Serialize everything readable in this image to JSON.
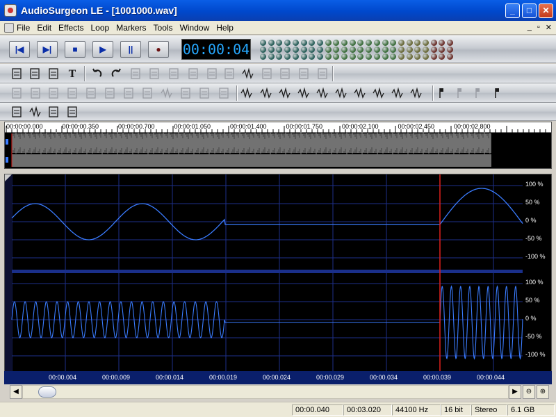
{
  "window": {
    "title": "AudioSurgeon LE - [1001000.wav]",
    "minimize": "_",
    "maximize": "□",
    "close": "✕"
  },
  "menu": {
    "items": [
      {
        "label": "File",
        "u": "F"
      },
      {
        "label": "Edit",
        "u": "E"
      },
      {
        "label": "Effects",
        "u": "c"
      },
      {
        "label": "Loop",
        "u": "L"
      },
      {
        "label": "Markers",
        "u": "M"
      },
      {
        "label": "Tools",
        "u": "T"
      },
      {
        "label": "Window",
        "u": "W"
      },
      {
        "label": "Help",
        "u": "H"
      }
    ],
    "mdi_controls": [
      "_",
      "▫",
      "✕"
    ]
  },
  "transport": {
    "buttons": [
      {
        "name": "skip-start-button",
        "glyph": "|◀"
      },
      {
        "name": "skip-end-button",
        "glyph": "▶|"
      },
      {
        "name": "stop-button",
        "glyph": "■"
      },
      {
        "name": "play-button",
        "glyph": "▶"
      },
      {
        "name": "pause-button",
        "glyph": "||"
      },
      {
        "name": "record-button",
        "glyph": "●"
      }
    ],
    "time": "00:00:04"
  },
  "overview": {
    "ruler_labels": [
      "00:00:00.000",
      "00:00:00.350",
      "00:00:00.700",
      "00:00:01.050",
      "00:00:01.400",
      "00:00:01.750",
      "00:00:02.100",
      "00:00:02.450",
      "00:00:02.800"
    ]
  },
  "wave": {
    "channel_labels": [
      "100 %",
      "50 %",
      "0 %",
      "-50 %",
      "-100 %"
    ],
    "time_ticks": [
      "00:00.004",
      "00:00.009",
      "00:00.014",
      "00:00.019",
      "00:00.024",
      "00:00.029",
      "00:00.034",
      "00:00.039",
      "00:00.044"
    ]
  },
  "status": {
    "position": "00:00.040",
    "length": "00:03.020",
    "sample_rate": "44100 Hz",
    "bit_depth": "16 bit",
    "channels": "Stereo",
    "disk_free": "6.1 GB"
  },
  "colors": {
    "wave": "#3a7cff",
    "grid": "#1e2f8a",
    "cursor": "#e0201c",
    "time_axis_bg": "#0a1f6b"
  }
}
